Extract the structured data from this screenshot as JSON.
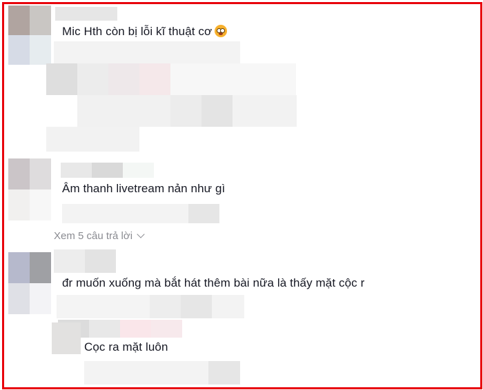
{
  "comments": [
    {
      "text": "Mic Hth còn bị lỗi kĩ thuật cơ",
      "emoji": "flushed-face-emoji"
    },
    {
      "text": "Âm thanh livetream nản như gì",
      "view_replies": "Xem 5 câu trả lời"
    },
    {
      "text": "đr muốn xuống mà bắt hát thêm bài nữa là thấy mặt cộc r"
    }
  ],
  "reply": {
    "text": "Cọc ra mặt luôn"
  },
  "colors": {
    "border": "#e8000b",
    "text": "#161823",
    "muted": "#8a8b91"
  }
}
